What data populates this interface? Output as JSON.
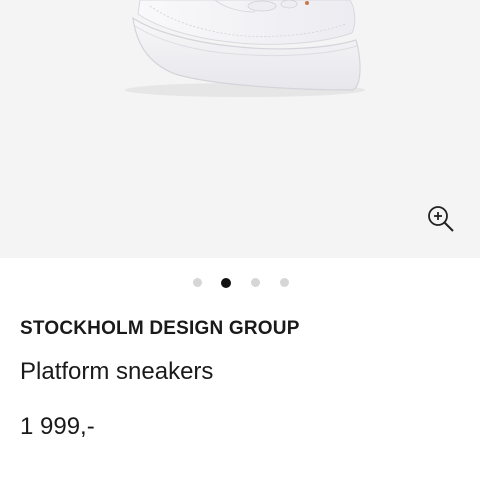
{
  "gallery": {
    "image_alt": "white platform sneaker",
    "zoom_icon": "zoom-in-icon",
    "slide_count": 4,
    "active_slide": 2
  },
  "product": {
    "brand": "STOCKHOLM DESIGN GROUP",
    "name": "Platform sneakers",
    "price": "1 999,-"
  },
  "colors": {
    "gallery_background": "#f4f4f4",
    "text": "#1a1a1a",
    "dot_inactive": "#d6d6d6",
    "dot_active": "#111111"
  }
}
